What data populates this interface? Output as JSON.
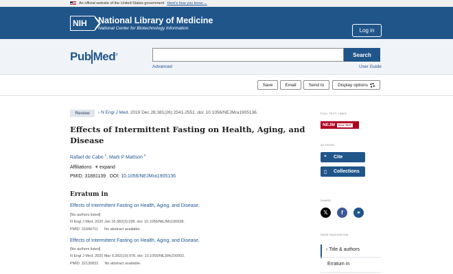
{
  "gov_banner": {
    "text": "An official website of the United States government",
    "link": "Here's how you know"
  },
  "header": {
    "logo_text": "NIH",
    "title": "National Library of Medicine",
    "subtitle": "National Center for Biotechnology Information",
    "login_label": "Log in"
  },
  "search": {
    "logo_pub": "Pub",
    "logo_med": "Med",
    "logo_reg": "®",
    "input_value": "",
    "button_label": "Search",
    "advanced_label": "Advanced",
    "user_guide_label": "User Guide"
  },
  "actions": {
    "save": "Save",
    "email": "Email",
    "send_to": "Send to",
    "display_options": "Display options"
  },
  "article": {
    "type_badge": "Review",
    "journal": "N Engl J Med.",
    "citation_rest": "2019 Dec 26;381(26):2541-2551. doi: 10.1056/NEJMra1905136.",
    "title": "Effects of Intermittent Fasting on Health, Aging, and Disease",
    "author1": "Rafael de Cabo",
    "author1_sup": "1",
    "author2": "Mark P Mattson",
    "author2_sup": "2",
    "affiliations_label": "Affiliations",
    "expand_label": "expand",
    "pmid_label": "PMID: 31881139",
    "doi_label": "DOI:",
    "doi_value": "10.1056/NEJMra1905136"
  },
  "erratum": {
    "heading": "Erratum in",
    "items": [
      {
        "title": "Effects of Intermittent Fasting on Health, Aging, and Disease.",
        "authors": "[No authors listed]",
        "citation": "N Engl J Med. 2020 Jan 16;382(3):298. doi: 10.1056/NEJMx190038.",
        "pmid": "PMID: 31940711",
        "abstract": "No abstract available."
      },
      {
        "title": "Effects of Intermittent Fasting on Health, Aging, and Disease.",
        "authors": "[No authors listed]",
        "citation": "N Engl J Med. 2020 Mar 5;382(10):978. doi: 10.1056/NEJMx200002.",
        "pmid": "PMID: 32130832",
        "abstract": "No abstract available."
      }
    ]
  },
  "sidebar": {
    "full_text_label": "FULL TEXT LINKS",
    "nejm_logo": "NEJM",
    "nejm_full_text": "FULL TEXT",
    "actions_label": "ACTIONS",
    "cite_label": "Cite",
    "collections_label": "Collections",
    "share_label": "SHARE",
    "page_nav_label": "PAGE NAVIGATION",
    "nav_items": [
      "Title & authors",
      "Erratum in"
    ]
  },
  "colors": {
    "primary": "#20558a",
    "link": "#205493",
    "nejm_red": "#b00020",
    "twitter": "#000000",
    "facebook": "#3b5998",
    "permalink": "#20558a"
  }
}
